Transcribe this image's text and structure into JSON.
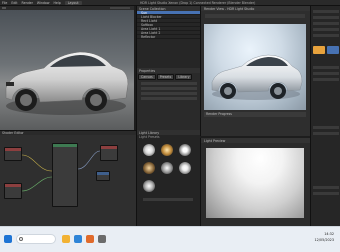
{
  "window": {
    "title": "HDR Light Studio Xenon (Drop 1) Connected Renderer (Blender Blender)",
    "render_view_title": "Render View - HDR Light Studio",
    "light_preview_title": "Light Preview"
  },
  "menu": {
    "items": [
      "File",
      "Edit",
      "Render",
      "Window",
      "Help"
    ],
    "workspace_tab": "Layout"
  },
  "outliner": {
    "header": "Scene Collection",
    "rows": [
      "Sun",
      "Light Blocker",
      "Rect Light",
      "Softbox",
      "Area Light 1",
      "Area Light 2",
      "Reflector"
    ]
  },
  "light_props": {
    "header": "Properties",
    "tabs": [
      "Canvas",
      "Presets",
      "Library"
    ]
  },
  "texture_pane": {
    "header": "Light Library",
    "sub_header": "Light Presets"
  },
  "render_bar": {
    "label": "Render Progress"
  },
  "node_editor": {
    "header": "Shader Editor"
  },
  "taskbar": {
    "time": "14:32",
    "date": "12/05/2023"
  },
  "colors": {
    "accent": "#e8a33d",
    "node_green": "#3e7a52",
    "node_blue": "#3f5f8c",
    "node_red": "#8c3f3f",
    "selection": "#4772b3"
  },
  "icons": [
    "search-icon",
    "windows-start-icon",
    "folder-icon",
    "browser-icon",
    "blender-icon",
    "settings-icon"
  ]
}
